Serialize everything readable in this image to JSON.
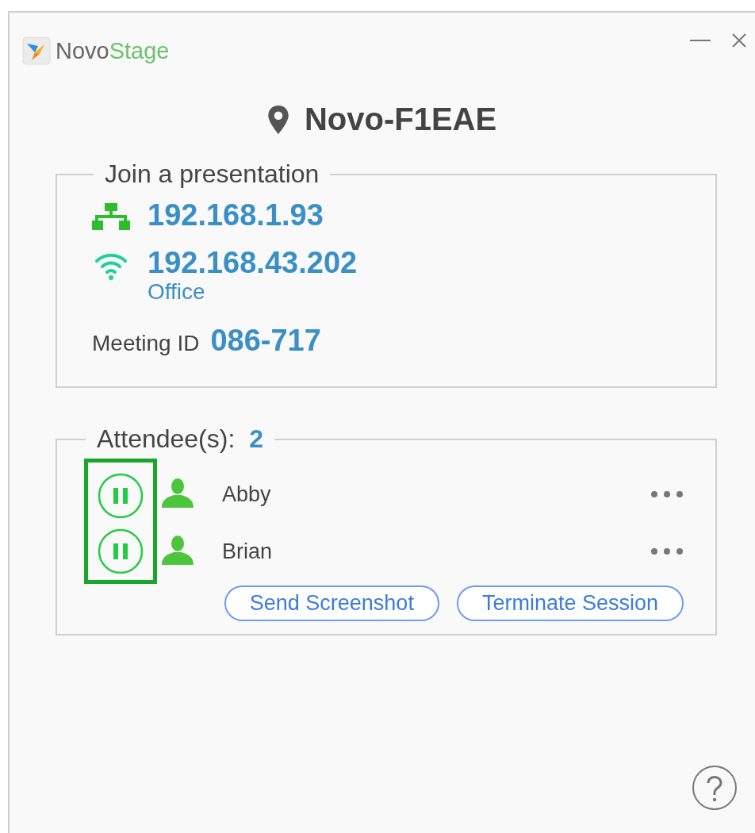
{
  "window": {
    "app_name": [
      "Novo",
      "Stage"
    ]
  },
  "device": {
    "name": "Novo-F1EAE"
  },
  "join": {
    "title": "Join a presentation",
    "connections": [
      {
        "kind": "wired",
        "address": "192.168.1.93"
      },
      {
        "kind": "wifi",
        "address": "192.168.43.202",
        "network": "Office"
      }
    ],
    "meeting_id_label": "Meeting ID",
    "meeting_id": "086-717"
  },
  "attendees": {
    "label": "Attendee(s):",
    "count": "2",
    "items": [
      {
        "name": "Abby"
      },
      {
        "name": "Brian"
      }
    ],
    "buttons": [
      "Send Screenshot",
      "Terminate Session"
    ]
  }
}
